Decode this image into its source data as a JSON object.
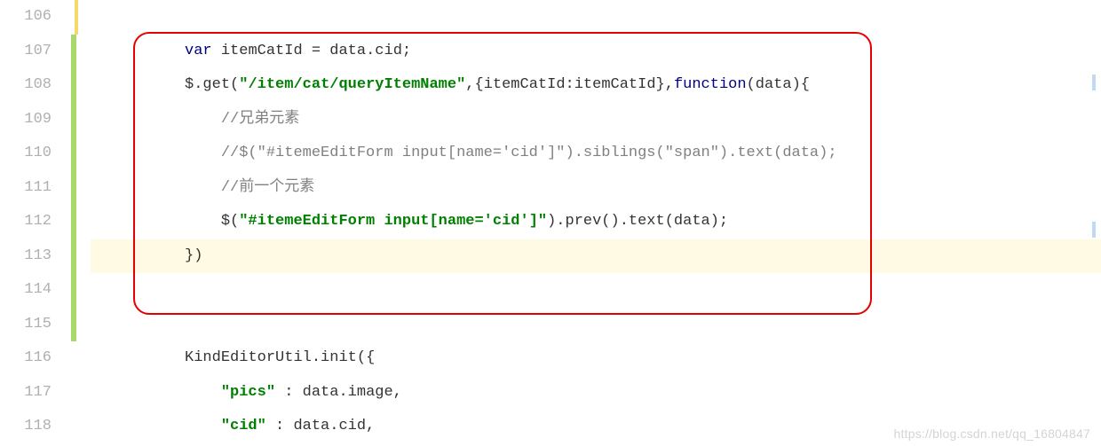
{
  "lineNumbers": [
    "106",
    "107",
    "108",
    "109",
    "110",
    "111",
    "112",
    "113",
    "114",
    "115",
    "116",
    "117",
    "118"
  ],
  "margins": [
    {
      "yellow": true
    },
    {
      "green": true
    },
    {
      "green": true
    },
    {
      "green": true
    },
    {
      "green": true
    },
    {
      "green": true
    },
    {
      "green": true
    },
    {
      "green": true
    },
    {
      "green": true
    },
    {
      "green": true
    },
    {},
    {},
    {}
  ],
  "rightMarks": [
    84,
    250
  ],
  "watermark": "https://blog.csdn.net/qq_16804847",
  "code": {
    "l107": {
      "indent": "          ",
      "kw": "var ",
      "name": "itemCatId",
      "tail": " = data.cid;"
    },
    "l108": {
      "indent": "          ",
      "pre": "$.get(",
      "str": "\"/item/cat/queryItemName\"",
      "mid": ",{itemCatId:itemCatId},",
      "kw": "function",
      "post": "(data){"
    },
    "l109": {
      "indent": "              ",
      "comment": "//兄弟元素"
    },
    "l110": {
      "indent": "              ",
      "comment": "//$(\"#itemeEditForm input[name='cid']\").siblings(\"span\").text(data);"
    },
    "l111": {
      "indent": "              ",
      "comment": "//前一个元素"
    },
    "l112": {
      "indent": "              ",
      "pre": "$(",
      "str": "\"#itemeEditForm input[name='cid']\"",
      "post": ").prev().text(data);"
    },
    "l113": {
      "indent": "          ",
      "text": "})"
    },
    "l116": {
      "indent": "          ",
      "text": "KindEditorUtil.init({"
    },
    "l117": {
      "indent": "              ",
      "str": "\"pics\"",
      "post": " : data.image,"
    },
    "l118": {
      "indent": "              ",
      "str": "\"cid\"",
      "post": " : data.cid,"
    }
  }
}
